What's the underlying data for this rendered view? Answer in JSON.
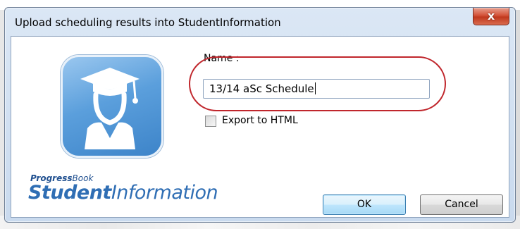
{
  "dialog": {
    "title": "Upload scheduling results into StudentInformation",
    "close_icon": "close-icon",
    "close_symbol": "x"
  },
  "branding": {
    "small_prefix": "Progress",
    "small_suffix": "Book",
    "large_prefix": "Student",
    "large_suffix": "Information",
    "logo_icon": "graduate-icon",
    "brand_color": "#2f6eb4",
    "tile_color": "#5b9fdc"
  },
  "form": {
    "name_label": "Name :",
    "name_value": "13/14 aSc Schedule",
    "export_label": "Export to HTML",
    "export_checked": false,
    "highlight_color": "#c0262c"
  },
  "buttons": {
    "ok_label": "OK",
    "cancel_label": "Cancel"
  }
}
